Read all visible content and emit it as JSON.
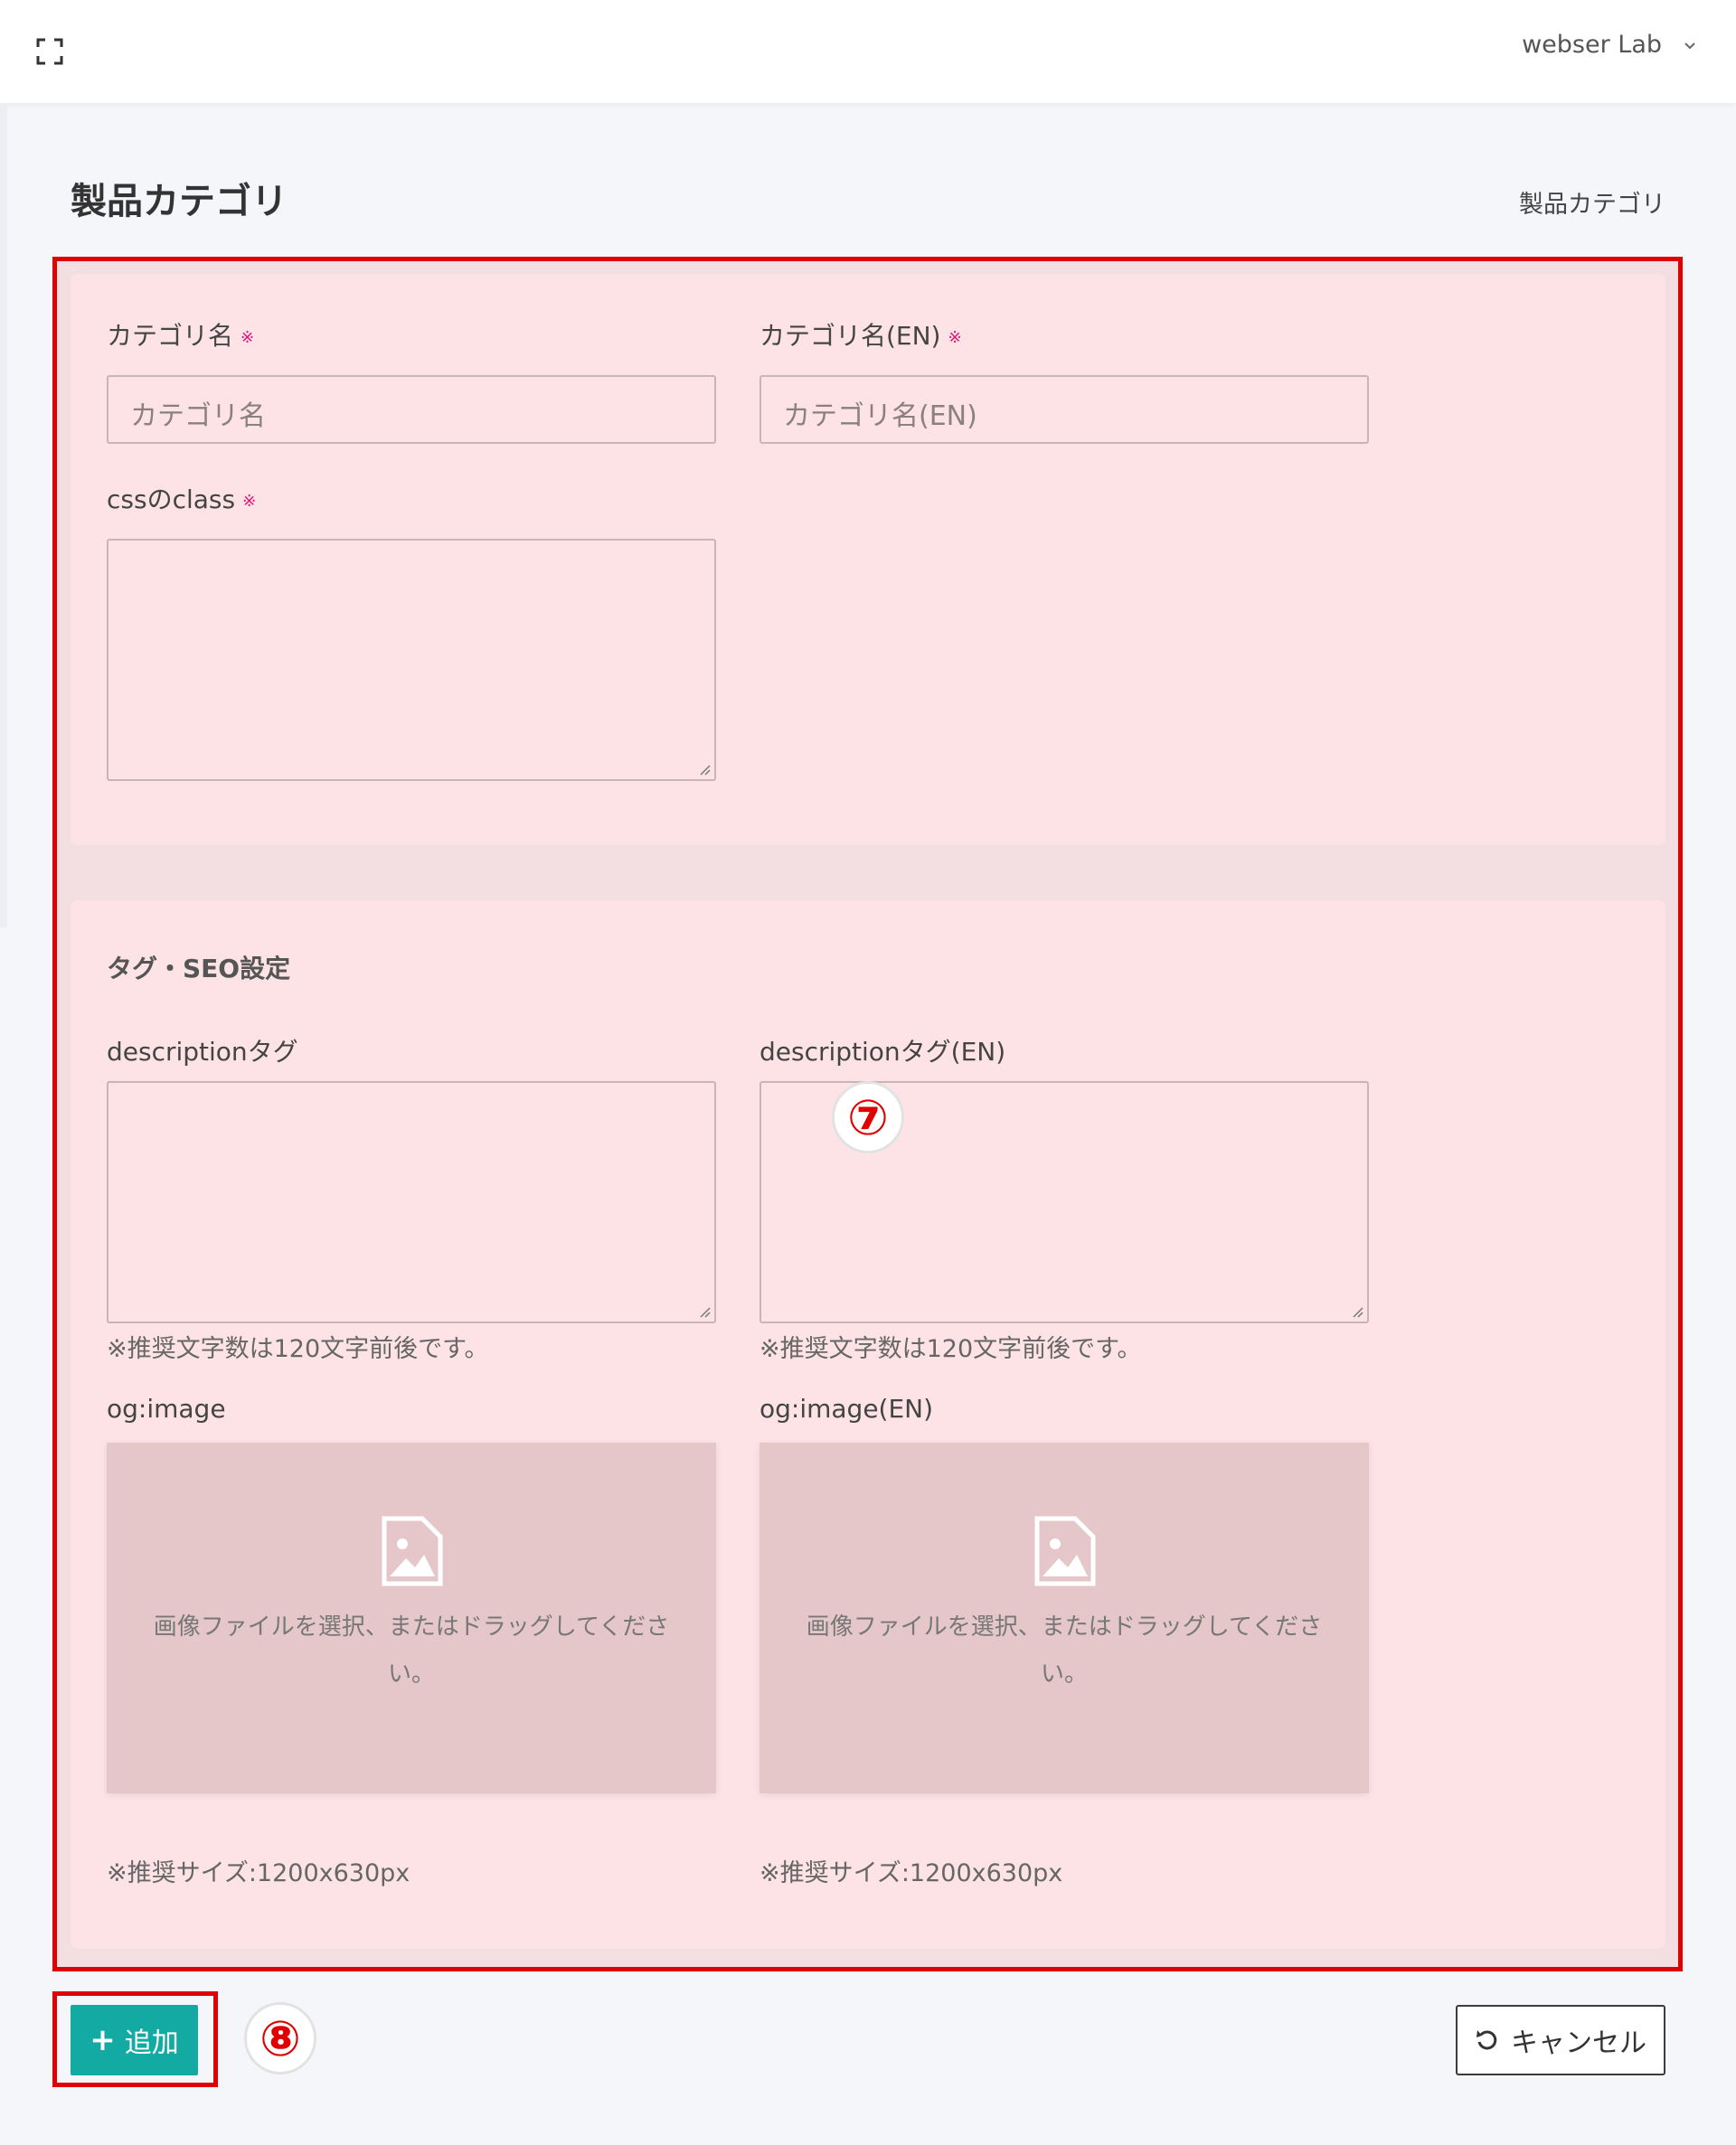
{
  "header": {
    "user_name": "webser Lab"
  },
  "page": {
    "title": "製品カテゴリ",
    "breadcrumb": "製品カテゴリ"
  },
  "form": {
    "required_mark": "※",
    "category_name": {
      "label": "カテゴリ名",
      "placeholder": "カテゴリ名"
    },
    "category_name_en": {
      "label": "カテゴリ名(EN)",
      "placeholder": "カテゴリ名(EN)"
    },
    "css_class": {
      "label": "cssのclass"
    },
    "seo": {
      "section_title": "タグ・SEO設定",
      "description": {
        "label": "descriptionタグ",
        "hint": "※推奨文字数は120文字前後です。"
      },
      "description_en": {
        "label": "descriptionタグ(EN)",
        "hint": "※推奨文字数は120文字前後です。"
      },
      "og_image": {
        "label": "og:image",
        "drop_text": "画像ファイルを選択、またはドラッグしてください。",
        "size_hint": "※推奨サイズ:1200x630px"
      },
      "og_image_en": {
        "label": "og:image(EN)",
        "drop_text": "画像ファイルを選択、またはドラッグしてください。",
        "size_hint": "※推奨サイズ:1200x630px"
      }
    }
  },
  "annotations": {
    "marker_7": "⑦",
    "marker_8": "⑧"
  },
  "actions": {
    "add_label": "追加",
    "cancel_label": "キャンセル"
  }
}
